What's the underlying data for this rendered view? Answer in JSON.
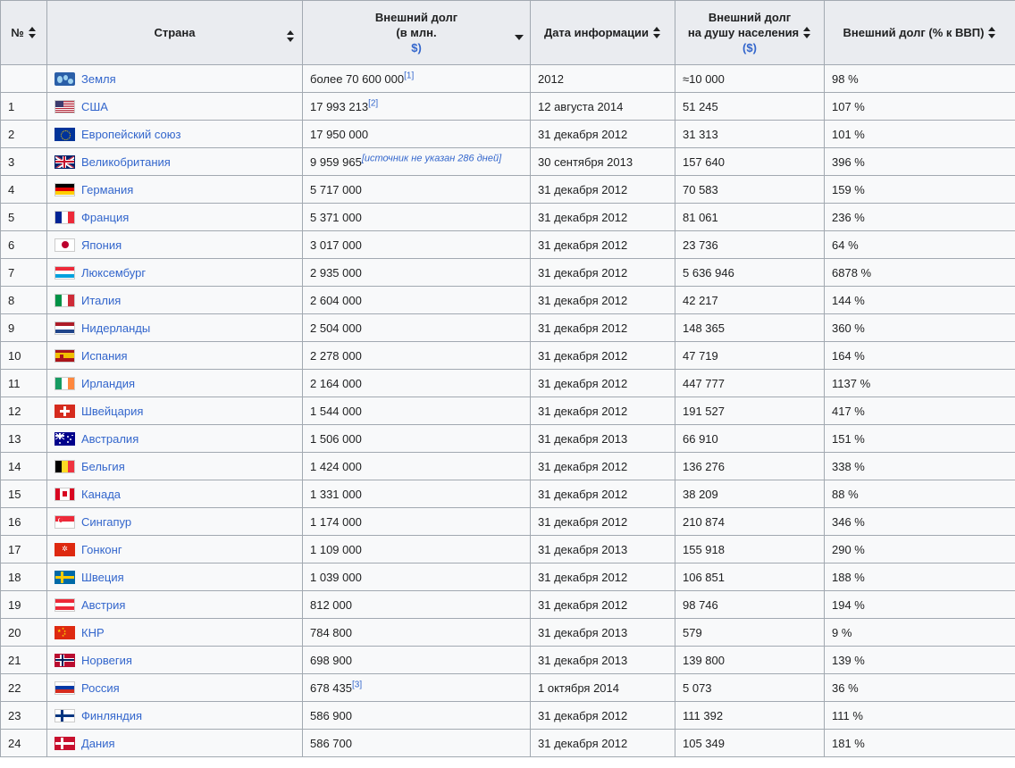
{
  "table": {
    "headers": {
      "num": "№",
      "country": "Страна",
      "debt_line1": "Внешний долг",
      "debt_line2": "(в млн.",
      "debt_line3": "$)",
      "date": "Дата информации",
      "percapita_line1": "Внешний долг",
      "percapita_line2": "на душу населения",
      "percapita_line3": "($)",
      "gdp": "Внешний долг (% к ВВП)"
    },
    "sort_state": {
      "active_column": "debt",
      "direction": "descending"
    },
    "rows": [
      {
        "num": "",
        "country": "Земля",
        "flag": "earth-flag-icon",
        "flag_class": "f-earth",
        "flag_parts": [
          "e1",
          "e2",
          "e3"
        ],
        "debt": "более 70 600 000",
        "debt_ref": "[1]",
        "debt_note": "",
        "date": "2012",
        "percapita": "≈10 000",
        "gdp": "98 %"
      },
      {
        "num": "1",
        "country": "США",
        "flag": "usa-flag-icon",
        "flag_class": "f-usa",
        "flag_parts": [
          "usa"
        ],
        "debt": "17 993 213",
        "debt_ref": "[2]",
        "debt_note": "",
        "date": "12 августа 2014",
        "percapita": "51 245",
        "gdp": "107 %"
      },
      {
        "num": "2",
        "country": "Европейский союз",
        "flag": "eu-flag-icon",
        "flag_class": "f-eu",
        "flag_parts": [
          "ring"
        ],
        "debt": "17 950 000",
        "debt_ref": "",
        "debt_note": "",
        "date": "31 декабря 2012",
        "percapita": "31 313",
        "gdp": "101 %"
      },
      {
        "num": "3",
        "country": "Великобритания",
        "flag": "uk-flag-icon",
        "flag_class": "f-uk",
        "flag_parts": [
          "d1",
          "d2",
          "d3",
          "d4",
          "hw",
          "vw",
          "hr",
          "vr"
        ],
        "debt": "9 959 965",
        "debt_ref": "",
        "debt_note": "[источник не указан 286 дней]",
        "date": "30 сентября 2013",
        "percapita": "157 640",
        "gdp": "396 %"
      },
      {
        "num": "4",
        "country": "Германия",
        "flag": "germany-flag-icon",
        "flag_class": "f-de",
        "flag_parts": [
          "b1",
          "b2",
          "b3"
        ],
        "debt": "5 717 000",
        "debt_ref": "",
        "debt_note": "",
        "date": "31 декабря 2012",
        "percapita": "70 583",
        "gdp": "159 %"
      },
      {
        "num": "5",
        "country": "Франция",
        "flag": "france-flag-icon",
        "flag_class": "f-fr",
        "flag_parts": [
          "v1",
          "v2",
          "v3"
        ],
        "debt": "5 371 000",
        "debt_ref": "",
        "debt_note": "",
        "date": "31 декабря 2012",
        "percapita": "81 061",
        "gdp": "236 %"
      },
      {
        "num": "6",
        "country": "Япония",
        "flag": "japan-flag-icon",
        "flag_class": "f-jp",
        "flag_parts": [
          "c"
        ],
        "debt": "3 017 000",
        "debt_ref": "",
        "debt_note": "",
        "date": "31 декабря 2012",
        "percapita": "23 736",
        "gdp": "64 %"
      },
      {
        "num": "7",
        "country": "Люксембург",
        "flag": "luxembourg-flag-icon",
        "flag_class": "f-lu",
        "flag_parts": [
          "b1",
          "b2",
          "b3"
        ],
        "debt": "2 935 000",
        "debt_ref": "",
        "debt_note": "",
        "date": "31 декабря 2012",
        "percapita": "5 636 946",
        "gdp": "6878 %"
      },
      {
        "num": "8",
        "country": "Италия",
        "flag": "italy-flag-icon",
        "flag_class": "f-it",
        "flag_parts": [
          "v1",
          "v2",
          "v3"
        ],
        "debt": "2 604 000",
        "debt_ref": "",
        "debt_note": "",
        "date": "31 декабря 2012",
        "percapita": "42 217",
        "gdp": "144 %"
      },
      {
        "num": "9",
        "country": "Нидерланды",
        "flag": "netherlands-flag-icon",
        "flag_class": "f-nl",
        "flag_parts": [
          "b1",
          "b2",
          "b3"
        ],
        "debt": "2 504 000",
        "debt_ref": "",
        "debt_note": "",
        "date": "31 декабря 2012",
        "percapita": "148 365",
        "gdp": "360 %"
      },
      {
        "num": "10",
        "country": "Испания",
        "flag": "spain-flag-icon",
        "flag_class": "f-es",
        "flag_parts": [
          "b1",
          "b2",
          "b3",
          "em"
        ],
        "debt": "2 278 000",
        "debt_ref": "",
        "debt_note": "",
        "date": "31 декабря 2012",
        "percapita": "47 719",
        "gdp": "164 %"
      },
      {
        "num": "11",
        "country": "Ирландия",
        "flag": "ireland-flag-icon",
        "flag_class": "f-ie",
        "flag_parts": [
          "v1",
          "v2",
          "v3"
        ],
        "debt": "2 164 000",
        "debt_ref": "",
        "debt_note": "",
        "date": "31 декабря 2012",
        "percapita": "447 777",
        "gdp": "1137 %"
      },
      {
        "num": "12",
        "country": "Швейцария",
        "flag": "switzerland-flag-icon",
        "flag_class": "f-ch",
        "flag_parts": [
          "h",
          "v"
        ],
        "debt": "1 544 000",
        "debt_ref": "",
        "debt_note": "",
        "date": "31 декабря 2012",
        "percapita": "191 527",
        "gdp": "417 %"
      },
      {
        "num": "13",
        "country": "Австралия",
        "flag": "australia-flag-icon",
        "flag_class": "f-au",
        "flag_parts": [
          "c1",
          "c2",
          "c3",
          "c4",
          "st1",
          "st2",
          "st3",
          "st4",
          "st5"
        ],
        "debt": "1 506 000",
        "debt_ref": "",
        "debt_note": "",
        "date": "31 декабря 2013",
        "percapita": "66 910",
        "gdp": "151 %"
      },
      {
        "num": "14",
        "country": "Бельгия",
        "flag": "belgium-flag-icon",
        "flag_class": "f-be",
        "flag_parts": [
          "v1",
          "v2",
          "v3"
        ],
        "debt": "1 424 000",
        "debt_ref": "",
        "debt_note": "",
        "date": "31 декабря 2012",
        "percapita": "136 276",
        "gdp": "338 %"
      },
      {
        "num": "15",
        "country": "Канада",
        "flag": "canada-flag-icon",
        "flag_class": "f-ca",
        "flag_parts": [
          "v1",
          "v2",
          "leaf"
        ],
        "debt": "1 331 000",
        "debt_ref": "",
        "debt_note": "",
        "date": "31 декабря 2012",
        "percapita": "38 209",
        "gdp": "88 %"
      },
      {
        "num": "16",
        "country": "Сингапур",
        "flag": "singapore-flag-icon",
        "flag_class": "f-sg",
        "flag_parts": [
          "top",
          "moon",
          "moon2"
        ],
        "debt": "1 174 000",
        "debt_ref": "",
        "debt_note": "",
        "date": "31 декабря 2012",
        "percapita": "210 874",
        "gdp": "346 %"
      },
      {
        "num": "17",
        "country": "Гонконг",
        "flag": "hongkong-flag-icon",
        "flag_class": "f-hk",
        "flag_parts": [
          "fl"
        ],
        "debt": "1 109 000",
        "debt_ref": "",
        "debt_note": "",
        "date": "31 декабря 2013",
        "percapita": "155 918",
        "gdp": "290 %"
      },
      {
        "num": "18",
        "country": "Швеция",
        "flag": "sweden-flag-icon",
        "flag_class": "f-se",
        "flag_parts": [
          "h",
          "v"
        ],
        "debt": "1 039 000",
        "debt_ref": "",
        "debt_note": "",
        "date": "31 декабря 2012",
        "percapita": "106 851",
        "gdp": "188 %"
      },
      {
        "num": "19",
        "country": "Австрия",
        "flag": "austria-flag-icon",
        "flag_class": "f-at",
        "flag_parts": [
          "b1",
          "b2",
          "b3"
        ],
        "debt": "812 000",
        "debt_ref": "",
        "debt_note": "",
        "date": "31 декабря 2012",
        "percapita": "98 746",
        "gdp": "194 %"
      },
      {
        "num": "20",
        "country": "КНР",
        "flag": "china-flag-icon",
        "flag_class": "f-cn",
        "flag_parts": [
          "s1",
          "s2",
          "s3",
          "s4",
          "s5"
        ],
        "debt": "784 800",
        "debt_ref": "",
        "debt_note": "",
        "date": "31 декабря 2013",
        "percapita": "579",
        "gdp": "9 %"
      },
      {
        "num": "21",
        "country": "Норвегия",
        "flag": "norway-flag-icon",
        "flag_class": "f-no",
        "flag_parts": [
          "hw",
          "vw",
          "hb",
          "vb"
        ],
        "debt": "698 900",
        "debt_ref": "",
        "debt_note": "",
        "date": "31 декабря 2013",
        "percapita": "139 800",
        "gdp": "139 %"
      },
      {
        "num": "22",
        "country": "Россия",
        "flag": "russia-flag-icon",
        "flag_class": "f-ru",
        "flag_parts": [
          "b1",
          "b2",
          "b3"
        ],
        "debt": "678 435",
        "debt_ref": "[3]",
        "debt_note": "",
        "date": "1 октября 2014",
        "percapita": "5 073",
        "gdp": "36 %"
      },
      {
        "num": "23",
        "country": "Финляндия",
        "flag": "finland-flag-icon",
        "flag_class": "f-fi",
        "flag_parts": [
          "h",
          "v"
        ],
        "debt": "586 900",
        "debt_ref": "",
        "debt_note": "",
        "date": "31 декабря 2012",
        "percapita": "111 392",
        "gdp": "111 %"
      },
      {
        "num": "24",
        "country": "Дания",
        "flag": "denmark-flag-icon",
        "flag_class": "f-dk",
        "flag_parts": [
          "h",
          "v"
        ],
        "debt": "586 700",
        "debt_ref": "",
        "debt_note": "",
        "date": "31 декабря 2012",
        "percapita": "105 349",
        "gdp": "181 %"
      }
    ]
  },
  "colors": {
    "link": "#3366cc",
    "header_bg": "#eaecf0",
    "cell_bg": "#f8f9fa",
    "border": "#a2a9b1",
    "text": "#202122"
  }
}
